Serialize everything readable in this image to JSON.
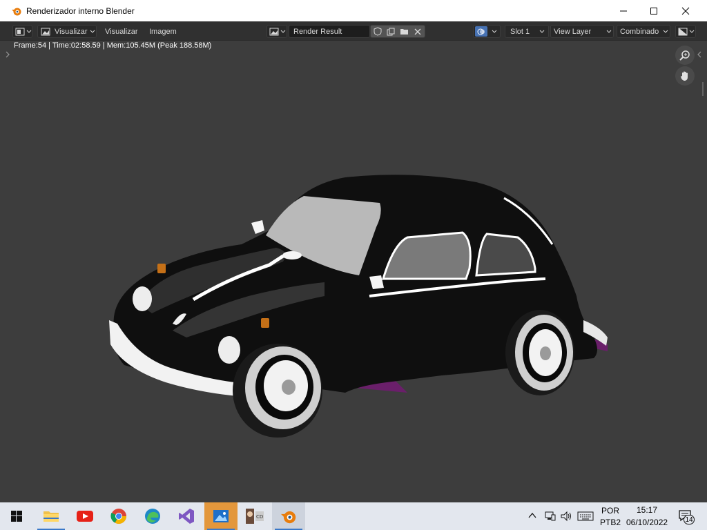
{
  "window": {
    "title": "Renderizador interno Blender"
  },
  "header": {
    "view_menu_label": "Visualizar",
    "view_menu2_label": "Visualizar",
    "image_menu_label": "Imagem",
    "image_name": "Render Result",
    "slot_label": "Slot 1",
    "view_layer_label": "View Layer",
    "pass_label": "Combinado"
  },
  "viewport": {
    "stats_text": "Frame:54 | Time:02:58.59 | Mem:105.45M (Peak 188.58M)"
  },
  "taskbar": {
    "apps": [
      "start",
      "file-explorer",
      "youtube",
      "chrome",
      "edge",
      "visual-studio",
      "photos",
      "media-app",
      "blender"
    ],
    "language_line1": "POR",
    "language_line2": "PTB2",
    "time": "15:17",
    "date": "06/10/2022",
    "notification_count": "14"
  },
  "colors": {
    "accent": "#4772b3",
    "blender_orange": "#e87d0d",
    "taskbar_bg": "#e3e7ee"
  }
}
